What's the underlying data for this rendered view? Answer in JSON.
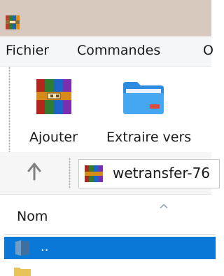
{
  "menu": {
    "items": [
      "Fichier",
      "Commandes",
      "O"
    ]
  },
  "toolbar": {
    "add_label": "Ajouter",
    "extract_label": "Extraire vers"
  },
  "address": {
    "value": "wetransfer-76"
  },
  "list": {
    "column_name": "Nom",
    "rows": [
      ".."
    ]
  },
  "icons": {
    "app": "winrar-books-icon",
    "add": "winrar-books-icon",
    "extract": "folder-extract-icon",
    "up": "up-arrow-icon",
    "address": "archive-icon",
    "row": "folder-up-icon"
  },
  "colors": {
    "titlebar": "#d7c9bd",
    "selection": "#0a78d7"
  }
}
